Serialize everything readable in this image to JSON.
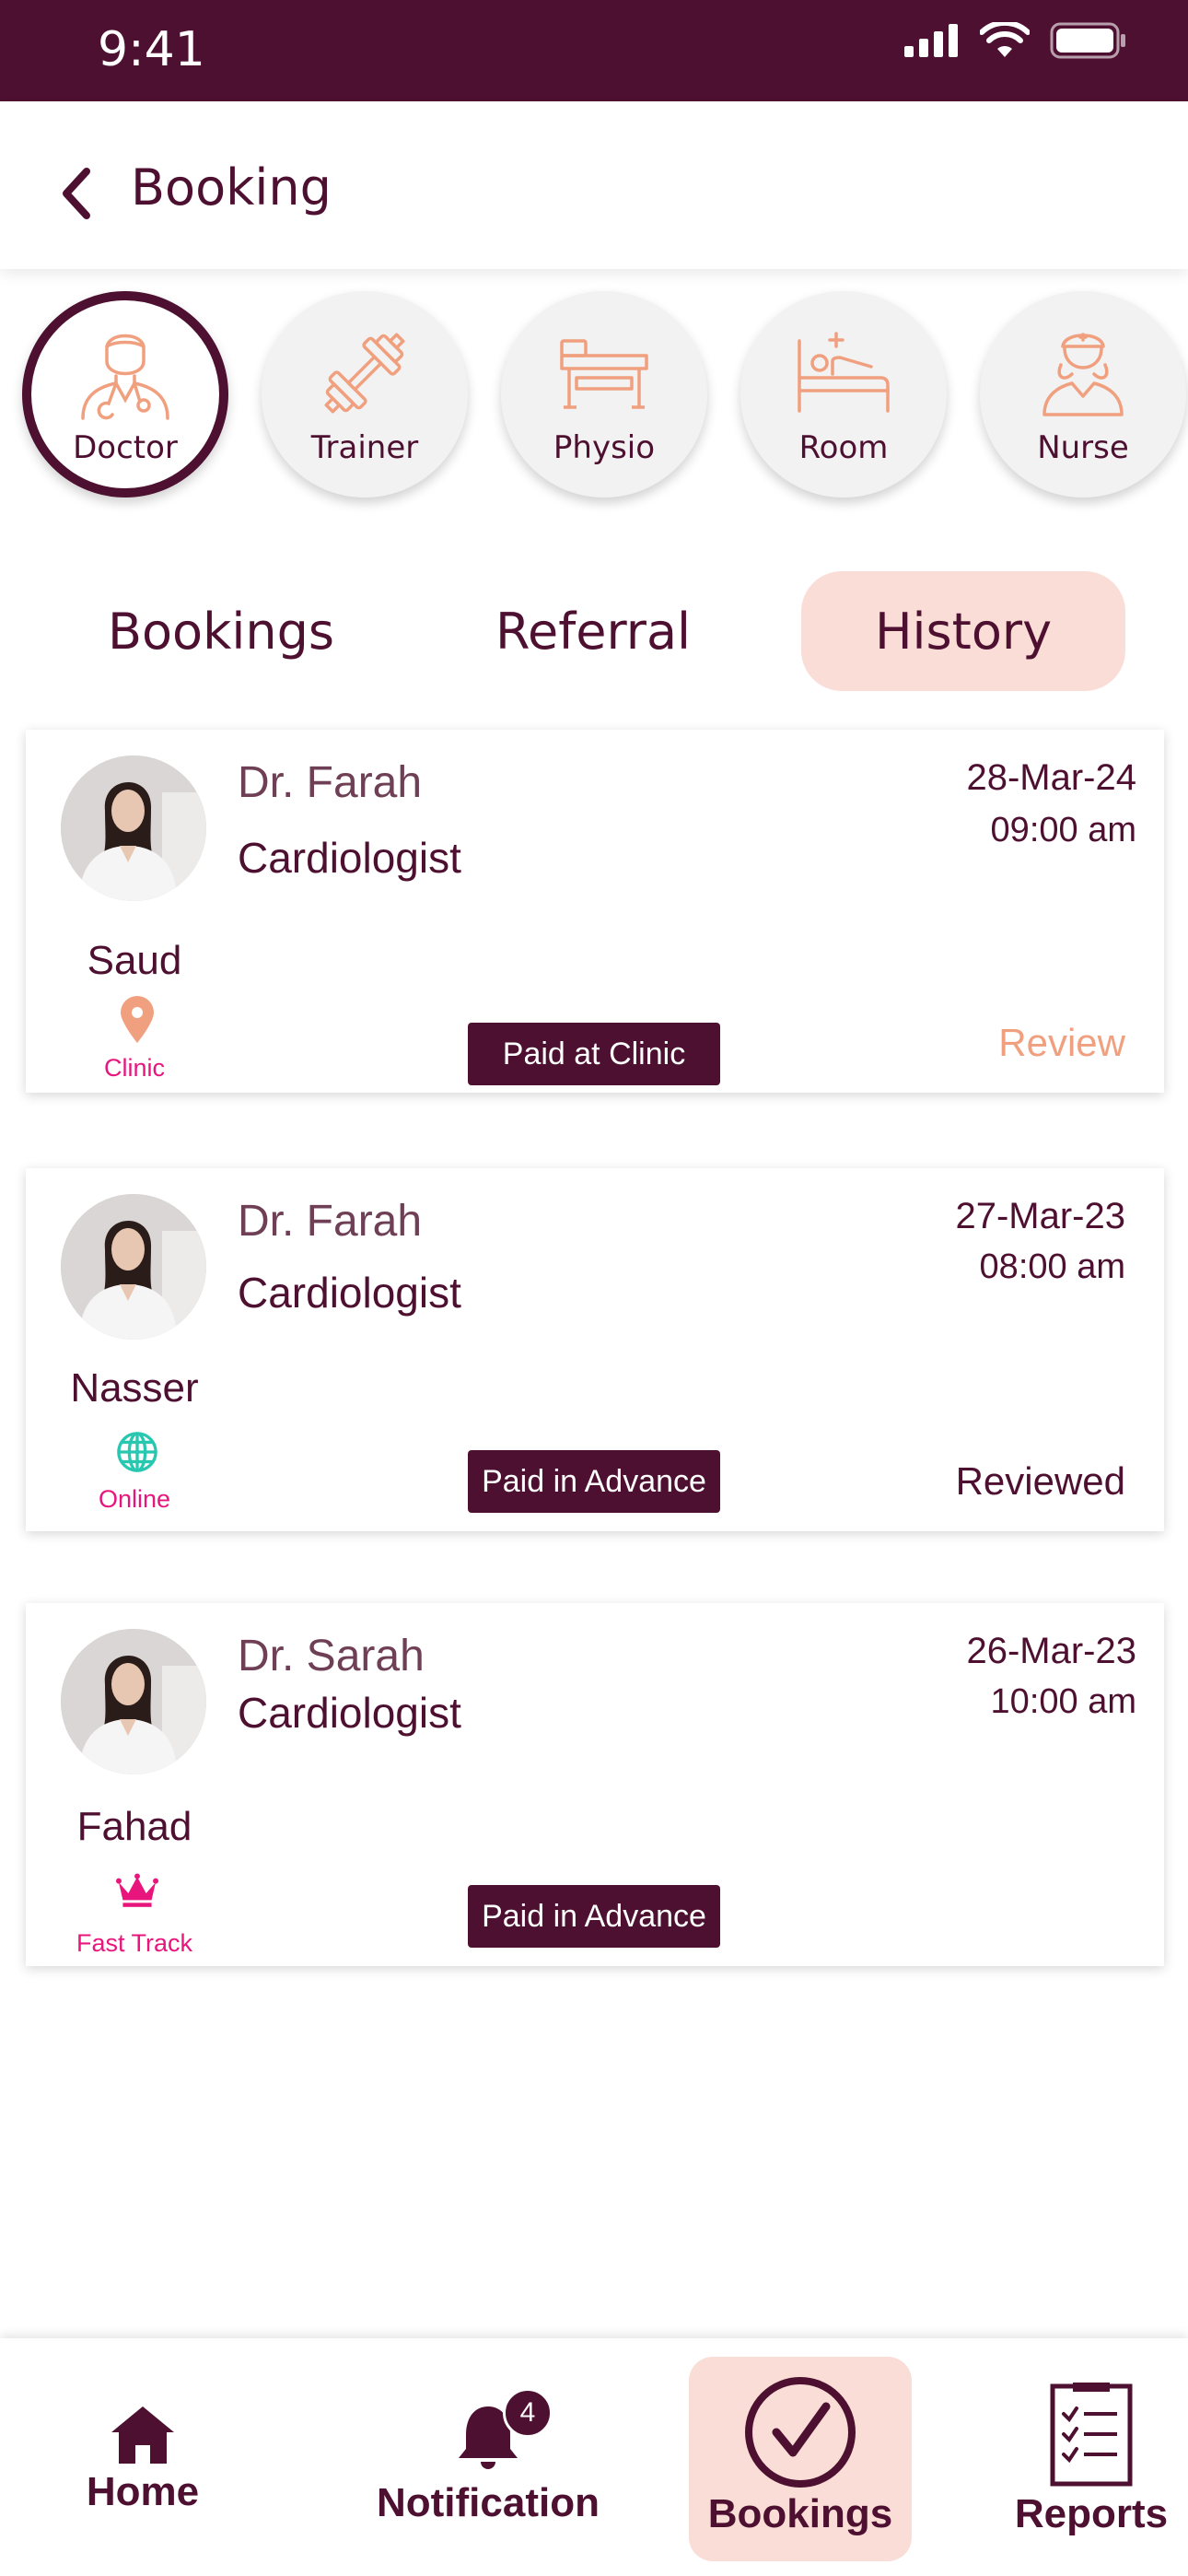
{
  "status_bar": {
    "time": "9:41"
  },
  "header": {
    "title": "Booking"
  },
  "categories": [
    {
      "label": "Doctor",
      "icon": "doctor-icon",
      "active": true
    },
    {
      "label": "Trainer",
      "icon": "dumbbell-icon",
      "active": false
    },
    {
      "label": "Physio",
      "icon": "physio-bed-icon",
      "active": false
    },
    {
      "label": "Room",
      "icon": "hospital-bed-icon",
      "active": false
    },
    {
      "label": "Nurse",
      "icon": "nurse-icon",
      "active": false
    }
  ],
  "tabs": [
    {
      "label": "Bookings",
      "active": false
    },
    {
      "label": "Referral",
      "active": false
    },
    {
      "label": "History",
      "active": true
    }
  ],
  "bookings": [
    {
      "doctor": "Dr. Farah",
      "specialty": "Cardiologist",
      "date": "28-Mar-24",
      "time": "09:00 am",
      "patient": "Saud",
      "mode": "Clinic",
      "mode_icon": "location-pin-icon",
      "payment": "Paid at Clinic",
      "action": "Review"
    },
    {
      "doctor": "Dr. Farah",
      "specialty": "Cardiologist",
      "date": "27-Mar-23",
      "time": "08:00 am",
      "patient": "Nasser",
      "mode": "Online",
      "mode_icon": "globe-icon",
      "payment": "Paid in Advance",
      "status": "Reviewed"
    },
    {
      "doctor": "Dr. Sarah",
      "specialty": "Cardiologist",
      "date": "26-Mar-23",
      "time": "10:00 am",
      "patient": "Fahad",
      "mode": "Fast Track",
      "mode_icon": "crown-icon",
      "payment": "Paid in Advance"
    }
  ],
  "bottom_nav": {
    "items": [
      {
        "label": "Home",
        "icon": "home-icon"
      },
      {
        "label": "Notification",
        "icon": "bell-icon",
        "badge": "4"
      },
      {
        "label": "Bookings",
        "icon": "check-circle-icon",
        "active": true
      },
      {
        "label": "Reports",
        "icon": "clipboard-icon"
      }
    ]
  },
  "colors": {
    "primary": "#4e1030",
    "accent_peach": "#f0a07e",
    "active_bg": "#f9ddd6",
    "pink": "#e8157d",
    "teal": "#27c7b0"
  }
}
